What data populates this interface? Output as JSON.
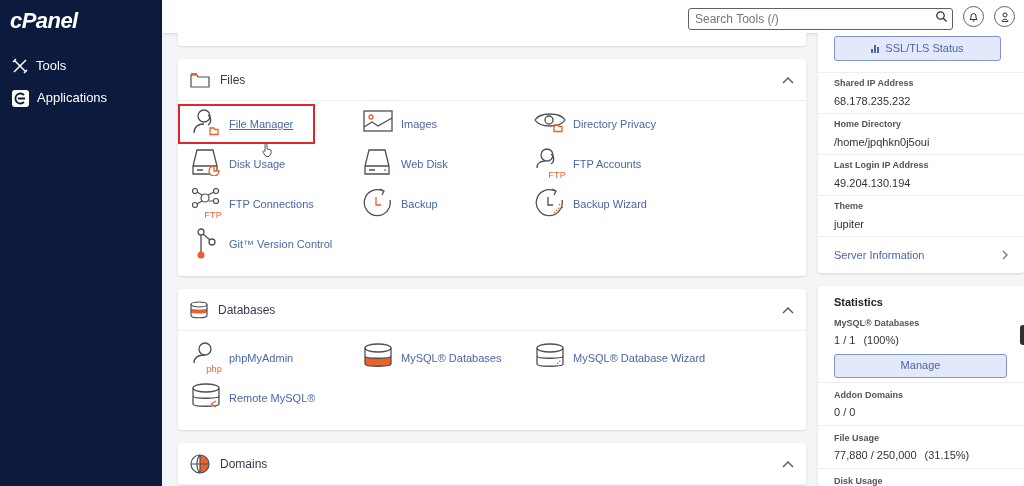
{
  "brand": "cPanel",
  "sidebar": {
    "items": [
      {
        "label": "Tools",
        "kind": "tools"
      },
      {
        "label": "Applications",
        "kind": "apps"
      }
    ]
  },
  "search": {
    "placeholder": "Search Tools (/)"
  },
  "sections": [
    {
      "title": "Files",
      "kind": "folder",
      "expanded": true,
      "items": [
        {
          "label": "File Manager",
          "kind": "file-manager",
          "highlighted": true
        },
        {
          "label": "Images",
          "kind": "images",
          "highlighted": false
        },
        {
          "label": "Directory Privacy",
          "kind": "privacy",
          "highlighted": false
        },
        {
          "label": "Disk Usage",
          "kind": "disk-usage",
          "highlighted": false
        },
        {
          "label": "Web Disk",
          "kind": "web-disk",
          "highlighted": false
        },
        {
          "label": "FTP Accounts",
          "kind": "ftp-accounts",
          "badge": "FTP",
          "highlighted": false
        },
        {
          "label": "FTP Connections",
          "kind": "ftp-connections",
          "badge": "FTP",
          "highlighted": false
        },
        {
          "label": "Backup",
          "kind": "backup",
          "highlighted": false
        },
        {
          "label": "Backup Wizard",
          "kind": "backup-wizard",
          "highlighted": false
        },
        {
          "label": "Git™ Version Control",
          "kind": "git",
          "highlighted": false
        }
      ]
    },
    {
      "title": "Databases",
      "kind": "database",
      "expanded": true,
      "items": [
        {
          "label": "phpMyAdmin",
          "kind": "phpmyadmin",
          "badge": "php",
          "highlighted": false
        },
        {
          "label": "MySQL® Databases",
          "kind": "mysql",
          "highlighted": false
        },
        {
          "label": "MySQL® Database Wizard",
          "kind": "mysql-wizard",
          "highlighted": false
        },
        {
          "label": "Remote MySQL®",
          "kind": "remote-mysql",
          "highlighted": false
        }
      ]
    },
    {
      "title": "Domains",
      "kind": "globe",
      "expanded": true
    }
  ],
  "info_panel": {
    "button": "SSL/TLS Status",
    "fields": [
      {
        "label": "Shared IP Address",
        "value": "68.178.235.232"
      },
      {
        "label": "Home Directory",
        "value": "/home/jpqhkn0j5oui"
      },
      {
        "label": "Last Login IP Address",
        "value": "49.204.130.194"
      },
      {
        "label": "Theme",
        "value": "jupiter"
      }
    ],
    "link": "Server Information"
  },
  "statistics": {
    "title": "Statistics",
    "items": [
      {
        "label": "MySQL® Databases",
        "value": "1 / 1",
        "percent": "(100%)",
        "button": "Manage"
      },
      {
        "label": "Addon Domains",
        "value": "0 / 0"
      },
      {
        "label": "File Usage",
        "value": "77,880 / 250,000",
        "percent": "(31.15%)"
      },
      {
        "label": "Disk Usage"
      }
    ]
  }
}
